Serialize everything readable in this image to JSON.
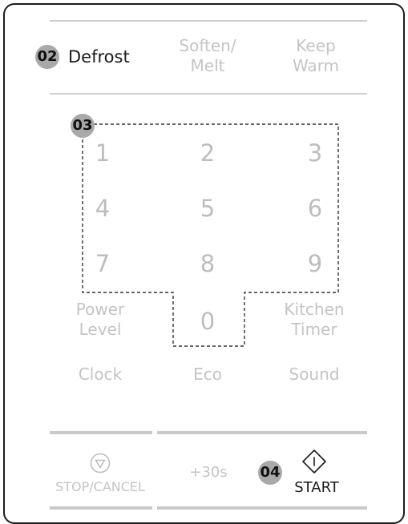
{
  "top_row": {
    "defrost_badge": "02",
    "defrost_label": "Defrost",
    "soften_line1": "Soften/",
    "soften_line2": "Melt",
    "keepwarm_line1": "Keep",
    "keepwarm_line2": "Warm"
  },
  "keypad": {
    "badge": "03",
    "keys": [
      "1",
      "2",
      "3",
      "4",
      "5",
      "6",
      "7",
      "8",
      "9",
      "0"
    ]
  },
  "function_row": {
    "power_line1": "Power",
    "power_line2": "Level",
    "kitchen_line1": "Kitchen",
    "kitchen_line2": "Timer",
    "clock": "Clock",
    "eco": "Eco",
    "sound": "Sound"
  },
  "bottom_row": {
    "stop_label": "STOP/CANCEL",
    "plus30": "+30s",
    "start_badge": "04",
    "start_label": "START"
  }
}
